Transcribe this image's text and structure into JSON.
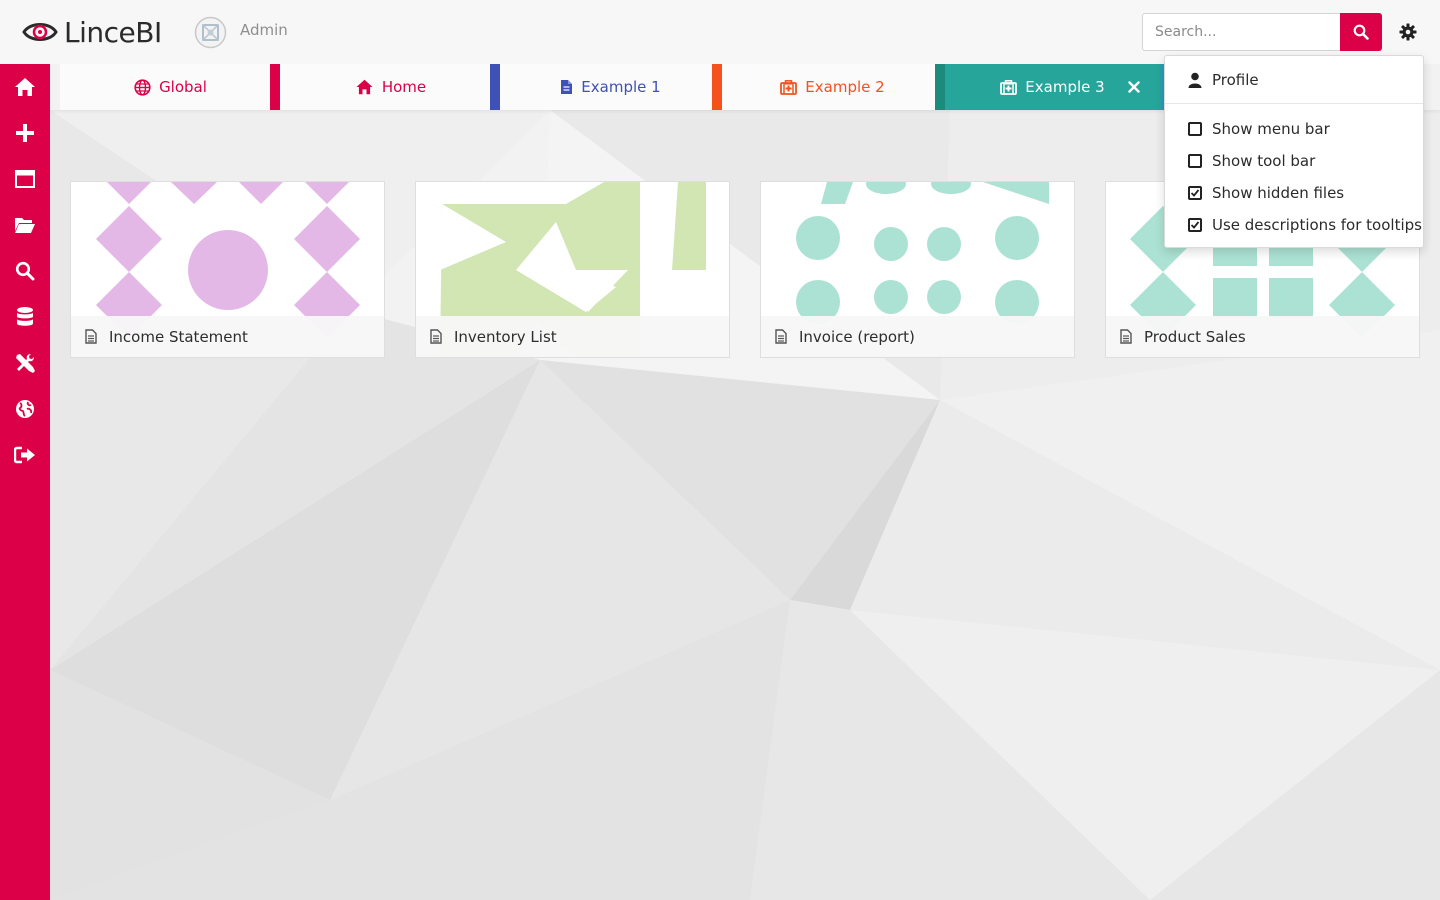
{
  "app": {
    "brand": "LinceBI",
    "user_name": "Admin",
    "accent_color": "#dc0048"
  },
  "search": {
    "placeholder": "Search..."
  },
  "sidebar": {
    "items": [
      {
        "icon": "home-icon"
      },
      {
        "icon": "plus-icon"
      },
      {
        "icon": "window-icon"
      },
      {
        "icon": "folder-open-icon"
      },
      {
        "icon": "search-icon"
      },
      {
        "icon": "database-icon"
      },
      {
        "icon": "tools-icon"
      },
      {
        "icon": "globe-icon"
      },
      {
        "icon": "sign-out-icon"
      }
    ]
  },
  "tabs": [
    {
      "label": "Global",
      "icon": "globe-icon",
      "color": "#dc0048",
      "active": false
    },
    {
      "label": "Home",
      "icon": "home-icon",
      "color": "#dc0048",
      "active": false
    },
    {
      "label": "Example 1",
      "icon": "file-icon",
      "color": "#3f51b5",
      "active": false
    },
    {
      "label": "Example 2",
      "icon": "medkit-icon",
      "color": "#f4511e",
      "active": false
    },
    {
      "label": "Example 3",
      "icon": "medkit-icon",
      "color": "#26a69a",
      "active": true
    }
  ],
  "cards": [
    {
      "title": "Income Statement",
      "pattern_color": "#e4b8e6",
      "icon": "file-icon"
    },
    {
      "title": "Inventory List",
      "pattern_color": "#d2e6b4",
      "icon": "file-icon"
    },
    {
      "title": "Invoice (report)",
      "pattern_color": "#ace2d3",
      "icon": "file-icon"
    },
    {
      "title": "Product Sales",
      "pattern_color": "#ace2d3",
      "icon": "file-icon"
    }
  ],
  "settings_menu": {
    "profile_label": "Profile",
    "options": [
      {
        "label": "Show menu bar",
        "checked": false
      },
      {
        "label": "Show tool bar",
        "checked": false
      },
      {
        "label": "Show hidden files",
        "checked": true
      },
      {
        "label": "Use descriptions for tooltips",
        "checked": true
      }
    ]
  }
}
